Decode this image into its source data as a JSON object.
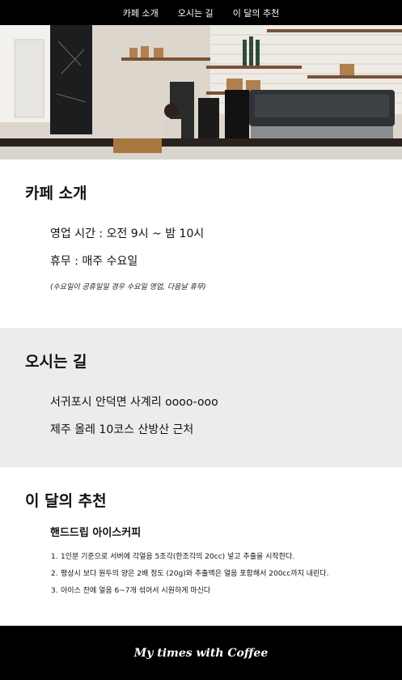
{
  "nav": {
    "items": [
      "카페 소개",
      "오시는 길",
      "이 달의 추천"
    ]
  },
  "hero": {
    "image_label": "cafe-counter-photo"
  },
  "about": {
    "title": "카페 소개",
    "hours": "영업 시간 : 오전 9시 ~ 밤 10시",
    "closed": "휴무 : 매주 수요일",
    "note": "(수요일이 공휴일일 경우 수요일 영업, 다음날 휴무)"
  },
  "route": {
    "title": "오시는 길",
    "address": "서귀포시 안덕면 사계리 oooo-ooo",
    "landmark": "제주 올레 10코스 산방산 근처"
  },
  "recommend": {
    "title": "이 달의 추천",
    "menu": "핸드드립 아이스커피",
    "steps": [
      "1인분 기준으로 서버에 각얼음 5조각(한조각의 20cc) 넣고 추출을 시작한다.",
      "평상시 보다 원두의 양은 2배 정도 (20g)와 추출액은 얼음 포함해서 200cc까지 내린다.",
      "아이스 잔에 얼음 6~7개 섞어서 시원하게 마신다"
    ]
  },
  "footer": {
    "text": "My times with Coffee"
  },
  "colors": {
    "nav_bg": "#000000",
    "section_alt_bg": "#ececec",
    "footer_bg": "#000000"
  }
}
